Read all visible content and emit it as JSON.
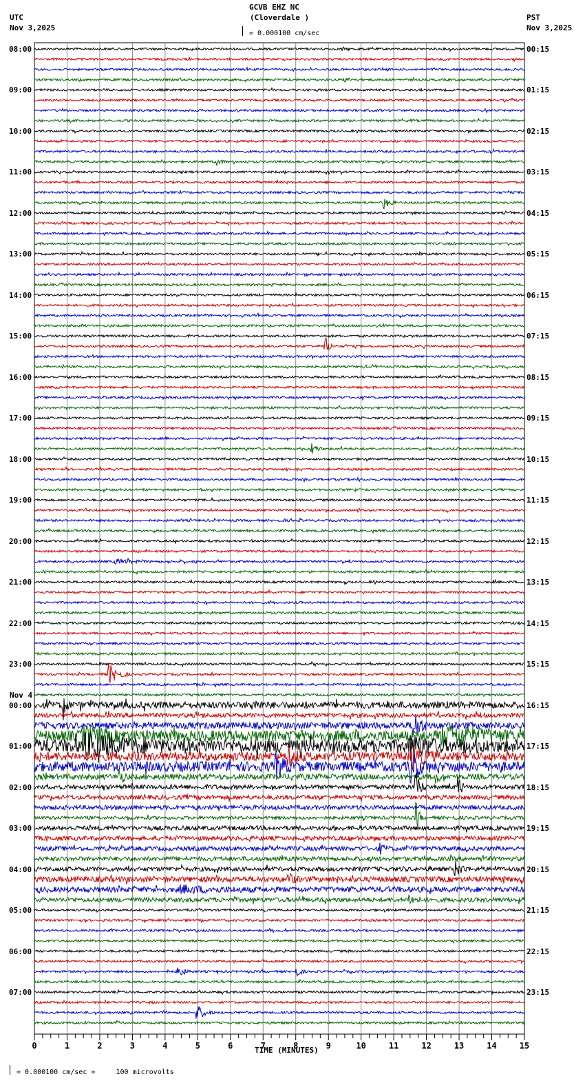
{
  "chart_data": {
    "type": "line",
    "title": "GCVB EHZ NC",
    "subtitle": "(Cloverdale )",
    "scale_label": "= 0.000100 cm/sec",
    "left_timezone": "UTC",
    "left_date": "Nov 3,2025",
    "right_timezone": "PST",
    "right_date": "Nov 3,2025",
    "date_change_label": "Nov 4",
    "xlabel": "TIME (MINUTES)",
    "xlim": [
      0,
      15
    ],
    "x_ticks": [
      "0",
      "1",
      "2",
      "3",
      "4",
      "5",
      "6",
      "7",
      "8",
      "9",
      "10",
      "11",
      "12",
      "13",
      "14",
      "15"
    ],
    "traces_per_hour": 4,
    "trace_colors": [
      "#000000",
      "#cc0000",
      "#0000cc",
      "#006600"
    ],
    "left_hour_labels": [
      "08:00",
      "09:00",
      "10:00",
      "11:00",
      "12:00",
      "13:00",
      "14:00",
      "15:00",
      "16:00",
      "17:00",
      "18:00",
      "19:00",
      "20:00",
      "21:00",
      "22:00",
      "23:00",
      "00:00",
      "01:00",
      "02:00",
      "03:00",
      "04:00",
      "05:00",
      "06:00",
      "07:00"
    ],
    "right_hour_labels": [
      "00:15",
      "01:15",
      "02:15",
      "03:15",
      "04:15",
      "05:15",
      "06:15",
      "07:15",
      "08:15",
      "09:15",
      "10:15",
      "11:15",
      "12:15",
      "13:15",
      "14:15",
      "15:15",
      "16:15",
      "17:15",
      "18:15",
      "19:15",
      "20:15",
      "21:15",
      "22:15",
      "23:15"
    ],
    "noise_levels": {
      "64": 3,
      "65": 2,
      "66": 3,
      "67": 5,
      "68": 6,
      "69": 4,
      "70": 4.5,
      "71": 2.5,
      "72": 2,
      "73": 2,
      "74": 2,
      "75": 1.5,
      "76": 2,
      "77": 2,
      "78": 2,
      "79": 2,
      "80": 2,
      "81": 2.5,
      "82": 2.5,
      "83": 2
    },
    "events": [
      [
        3,
        9.5,
        0.6,
        2
      ],
      [
        11,
        5.6,
        0.3,
        5
      ],
      [
        15,
        10.7,
        0.4,
        8
      ],
      [
        29,
        8.9,
        0.3,
        14
      ],
      [
        39,
        8.5,
        0.3,
        8
      ],
      [
        50,
        2.5,
        1.2,
        3
      ],
      [
        61,
        2.3,
        0.6,
        14
      ],
      [
        64,
        0.9,
        0.2,
        18
      ],
      [
        64,
        6.7,
        0.4,
        6
      ],
      [
        66,
        11.6,
        0.5,
        20
      ],
      [
        67,
        1.5,
        1.5,
        10
      ],
      [
        67,
        12.5,
        2.5,
        12
      ],
      [
        68,
        1.5,
        2.5,
        14
      ],
      [
        68,
        11.5,
        1.0,
        14
      ],
      [
        69,
        7.8,
        0.5,
        10
      ],
      [
        69,
        11.6,
        0.8,
        14
      ],
      [
        70,
        7.4,
        0.5,
        14
      ],
      [
        70,
        11.5,
        0.6,
        20
      ],
      [
        71,
        2.6,
        0.3,
        10
      ],
      [
        71,
        12.3,
        0.2,
        10
      ],
      [
        72,
        11.7,
        0.3,
        18
      ],
      [
        72,
        13.0,
        0.2,
        14
      ],
      [
        75,
        11.7,
        0.2,
        20
      ],
      [
        78,
        10.6,
        0.3,
        6
      ],
      [
        80,
        12.9,
        0.4,
        10
      ],
      [
        81,
        7.8,
        0.3,
        8
      ],
      [
        82,
        4.5,
        2.0,
        4
      ],
      [
        83,
        11.5,
        0.3,
        8
      ],
      [
        90,
        4.4,
        0.4,
        8
      ],
      [
        90,
        8.0,
        0.3,
        8
      ],
      [
        94,
        5.0,
        0.5,
        10
      ]
    ]
  },
  "footer": {
    "scale_note": "= 0.000100 cm/sec =     100 microvolts"
  }
}
